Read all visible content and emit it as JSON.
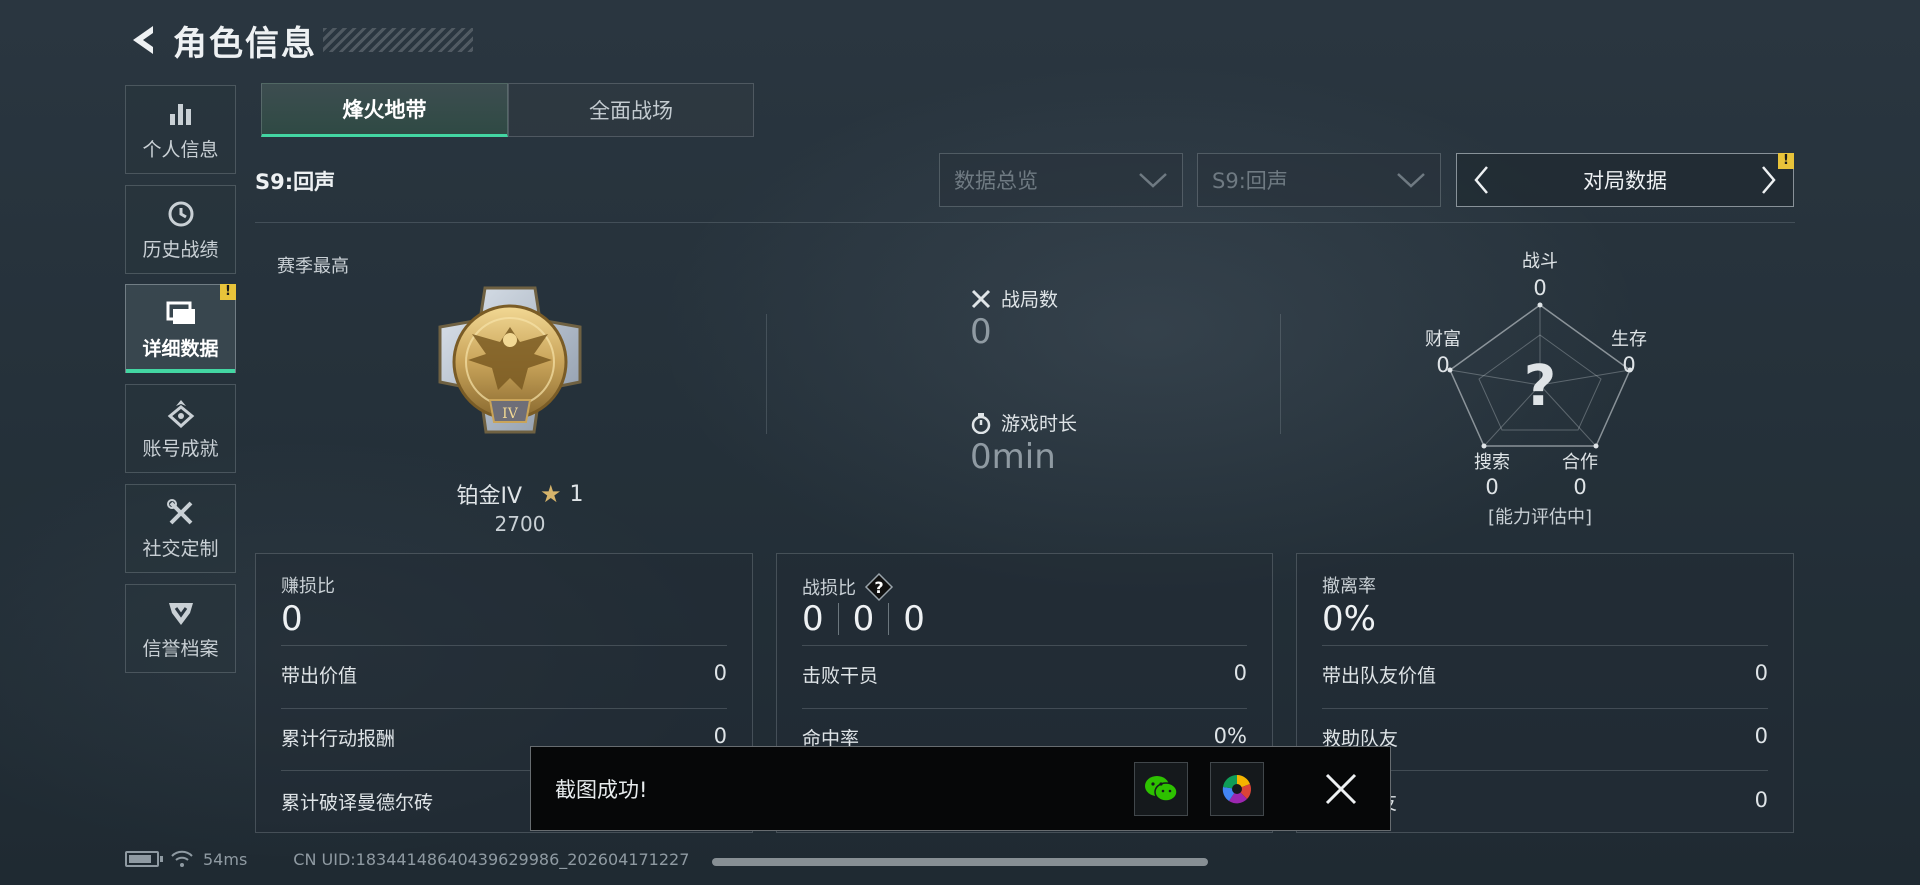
{
  "header": {
    "title": "角色信息"
  },
  "sidebar": {
    "items": [
      {
        "label": "个人信息",
        "icon": "bar-chart-icon"
      },
      {
        "label": "历史战绩",
        "icon": "history-clock-icon"
      },
      {
        "label": "详细数据",
        "icon": "folder-icon",
        "active": true,
        "badge": "!"
      },
      {
        "label": "账号成就",
        "icon": "achievement-icon"
      },
      {
        "label": "社交定制",
        "icon": "tools-icon"
      },
      {
        "label": "信誉档案",
        "icon": "shield-icon"
      }
    ]
  },
  "tabs": [
    {
      "label": "烽火地带",
      "active": true
    },
    {
      "label": "全面战场",
      "active": false
    }
  ],
  "season_label": "S9:回声",
  "filters": {
    "dropdown_1": "数据总览",
    "dropdown_2": "S9:回声",
    "pager_label": "对局数据",
    "pager_badge": "!"
  },
  "rank": {
    "caption": "赛季最高",
    "name": "铂金IV",
    "stars": "1",
    "score": "2700",
    "medal_numeral": "IV"
  },
  "battles": {
    "label": "战局数",
    "value": "0"
  },
  "playtime": {
    "label": "游戏时长",
    "value": "0min"
  },
  "radar": {
    "axes": [
      {
        "label": "战斗",
        "value": "0"
      },
      {
        "label": "生存",
        "value": "0"
      },
      {
        "label": "合作",
        "value": "0"
      },
      {
        "label": "搜索",
        "value": "0"
      },
      {
        "label": "财富",
        "value": "0"
      }
    ],
    "center": "?",
    "status": "[能力评估中]"
  },
  "cards": [
    {
      "title": "赚损比",
      "big": "0",
      "rows": [
        {
          "label": "带出价值",
          "value": "0"
        },
        {
          "label": "累计行动报酬",
          "value": "0"
        },
        {
          "label": "累计破译曼德尔砖",
          "value": ""
        }
      ]
    },
    {
      "title": "战损比",
      "big_parts": [
        "0",
        "0",
        "0"
      ],
      "rows": [
        {
          "label": "击败干员",
          "value": "0"
        },
        {
          "label": "命中率",
          "value": "0%"
        },
        {
          "label": "",
          "value": ""
        }
      ]
    },
    {
      "title": "撤离率",
      "big": "0%",
      "rows": [
        {
          "label": "带出队友价值",
          "value": "0"
        },
        {
          "label": "救助队友",
          "value": "0"
        },
        {
          "label": "友",
          "value": "0"
        }
      ]
    }
  ],
  "toast": {
    "text": "截图成功!"
  },
  "status": {
    "ping": "54ms",
    "uid": "CN UID:18344148640439629986_202604171227"
  },
  "colors": {
    "accent": "#43d6a2",
    "badge": "#e8c33a",
    "medal": "#c9a45a"
  }
}
